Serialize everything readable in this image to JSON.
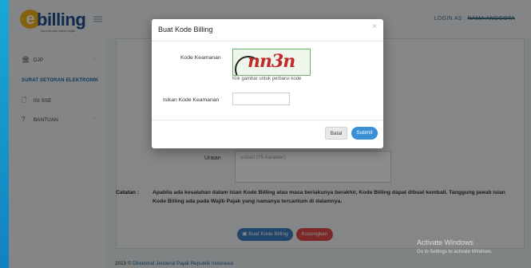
{
  "header": {
    "logo_text": "billing",
    "logo_tagline": "cara mudah bayar pajak",
    "login_prefix": "LOGIN AS :",
    "login_name": "NAMA ANGGOTA"
  },
  "sidebar": {
    "items": [
      {
        "label": "DJP",
        "icon": "bank-icon"
      },
      {
        "label": "ISI SSE",
        "icon": "document-icon"
      },
      {
        "label": "BANTUAN",
        "icon": "question-icon"
      }
    ],
    "section_title": "SURAT SETORAN ELEKTRONIK"
  },
  "form": {
    "uraian_label": "Uraian",
    "uraian_placeholder": "uraian (75 karakter)"
  },
  "note": {
    "label": "Catatan :",
    "text": "Apabila ada kesalahan dalam isian Kode Billing atau masa berlakunya berakhir, Kode Billing dapat dibuat kembali. Tanggung jawab isian Kode Billing ada pada Wajib Pajak yang namanya tercantum di dalamnya."
  },
  "actions": {
    "buat_label": "Buat Kode Billing",
    "kosongkan_label": "Kosongkan"
  },
  "footer": {
    "prefix": "2019 ©",
    "link": "Direktorat Jenderal Pajak Republik Indonesia"
  },
  "watermark": {
    "line1": "Activate Windows",
    "line2": "Go to Settings to activate Windows."
  },
  "modal": {
    "title": "Buat Kode Billing",
    "close_symbol": "×",
    "kode_label": "Kode Keamanan",
    "captcha_text": "nn3n",
    "captcha_hint": "Klik gambar untuk perbarui kode",
    "isian_label": "Isikan Kode Keamanan",
    "isian_value": "",
    "batal_label": "Batal",
    "submit_label": "Submit"
  },
  "colors": {
    "accent": "#3a8fd6",
    "danger": "#e24a4a",
    "brand": "#1e4f8c",
    "logo_yellow": "#f0b21a"
  }
}
